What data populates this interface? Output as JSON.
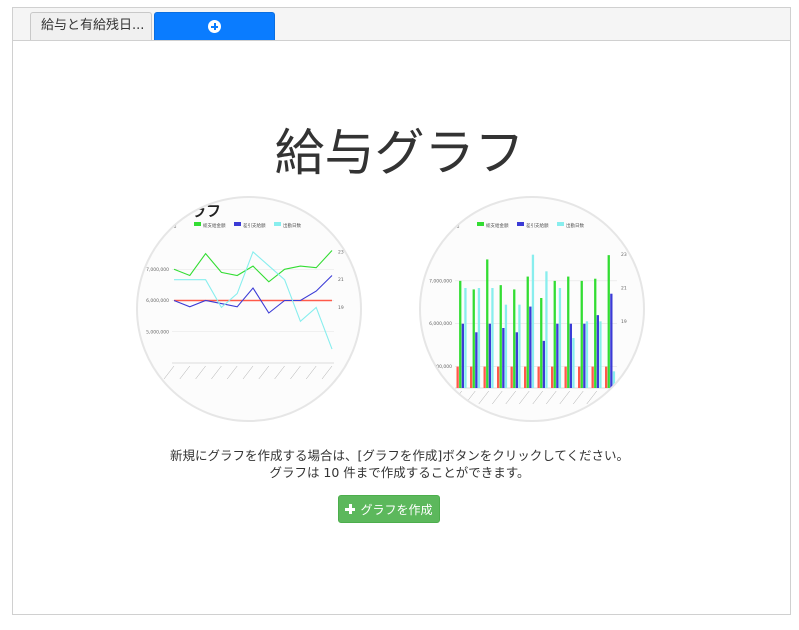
{
  "tabs": [
    {
      "label": "給与と有給残日..."
    },
    {
      "label": "",
      "icon": "plus-circle-icon"
    }
  ],
  "main": {
    "title": "給与グラフ",
    "description_line1": "新規にグラフを作成する場合は、[グラフを作成]ボタンをクリックしてください。",
    "description_line2": "グラフは 10 件まで作成することができます。",
    "create_button_label": "グラフを作成",
    "create_button_icon": "plus-icon"
  },
  "colors": {
    "tab_active": "#0a7cff",
    "button": "#5cb85c",
    "series_base": "#ff5a4a",
    "series_total": "#33dd33",
    "series_deduction": "#3b3bd6",
    "series_days": "#88eeee"
  },
  "chart_data": [
    {
      "type": "line",
      "title": "グラフ",
      "series": [
        {
          "name": "基本給",
          "values": [
            6000000,
            6000000,
            6000000,
            6000000,
            6000000,
            6000000,
            6000000,
            6000000,
            6000000,
            6000000,
            6000000
          ]
        },
        {
          "name": "総支給金額",
          "values": [
            7000000,
            6800000,
            7500000,
            6900000,
            6800000,
            7100000,
            6600000,
            7000000,
            7100000,
            7050000,
            7600000
          ]
        },
        {
          "name": "差引支給額",
          "values": [
            6000000,
            5800000,
            6000000,
            5900000,
            5800000,
            6400000,
            5600000,
            6000000,
            6000000,
            6300000,
            6800000
          ]
        },
        {
          "name": "出勤日数",
          "values": [
            21,
            21,
            21,
            19,
            20,
            23,
            22,
            21,
            18,
            19,
            16
          ]
        }
      ],
      "y_ticks": [
        "5,000,000",
        "6,000,000",
        "7,000,000"
      ],
      "y2_ticks": [
        "19",
        "21",
        "23"
      ],
      "legend": "top"
    },
    {
      "type": "bar",
      "series": [
        {
          "name": "基本給",
          "values": [
            5000000,
            5000000,
            5000000,
            5000000,
            5000000,
            5000000,
            5000000,
            5000000,
            5000000,
            5000000,
            5000000,
            5000000
          ]
        },
        {
          "name": "総支給金額",
          "values": [
            7000000,
            6800000,
            7500000,
            6900000,
            6800000,
            7100000,
            6600000,
            7000000,
            7100000,
            7000000,
            7050000,
            7600000
          ]
        },
        {
          "name": "差引支給額",
          "values": [
            6000000,
            5800000,
            6000000,
            5900000,
            5800000,
            6400000,
            5600000,
            6000000,
            6000000,
            6000000,
            6200000,
            6700000
          ]
        },
        {
          "name": "出勤日数",
          "values": [
            21,
            21,
            21,
            20,
            20,
            23,
            22,
            21,
            18,
            19,
            19,
            16
          ]
        }
      ],
      "y_ticks": [
        "5,000,000",
        "6,000,000",
        "7,000,000"
      ],
      "y2_ticks": [
        "19",
        "21",
        "23"
      ],
      "legend": "top"
    }
  ]
}
